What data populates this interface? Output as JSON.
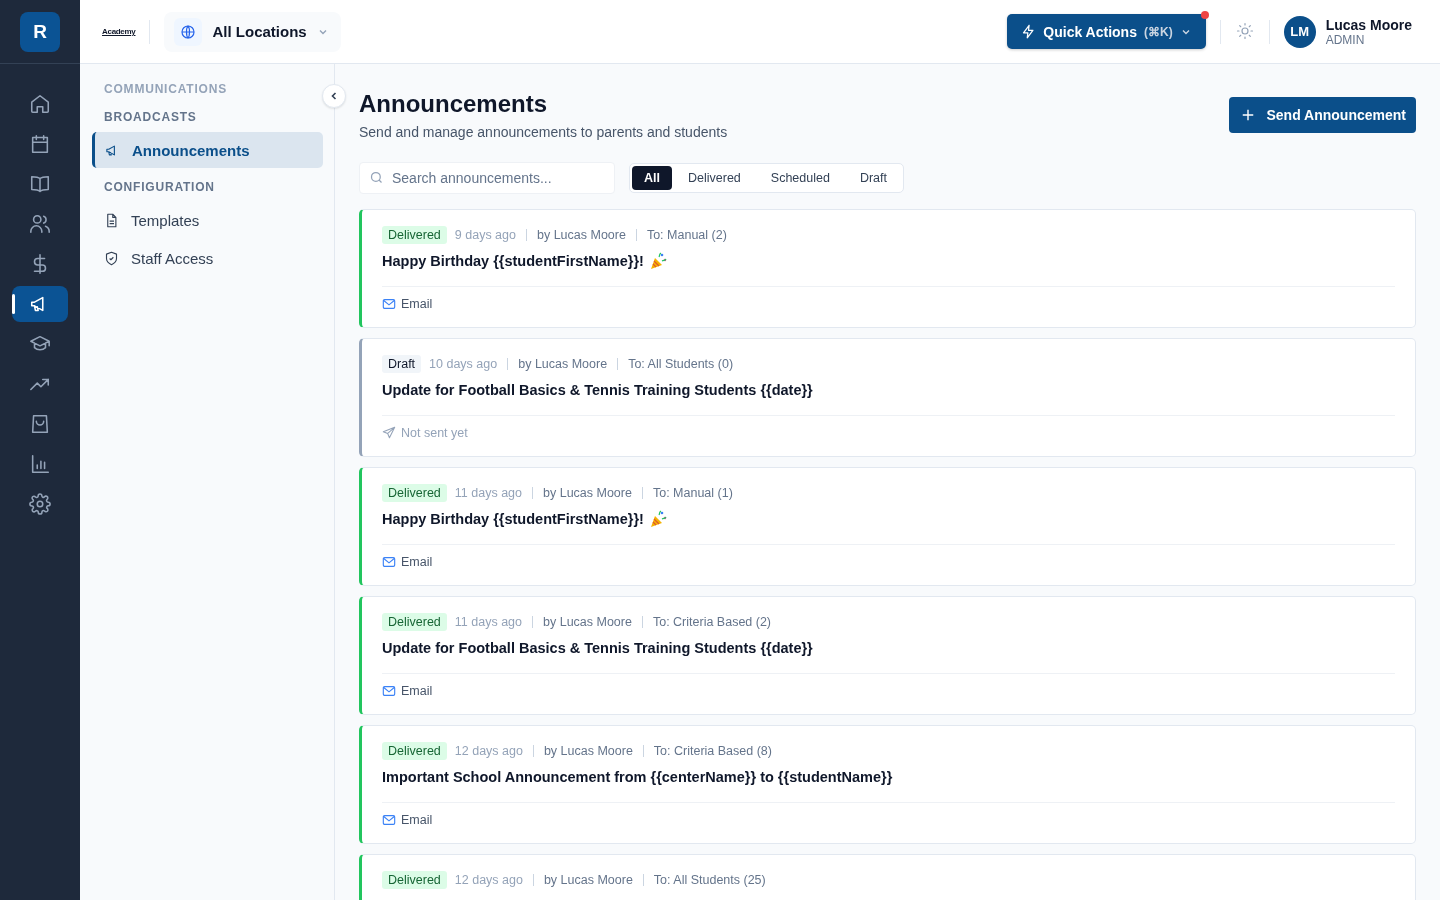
{
  "rail": {
    "logo": "R",
    "items": [
      {
        "selected": false
      },
      {
        "selected": false
      },
      {
        "selected": false
      },
      {
        "selected": false
      },
      {
        "selected": false
      },
      {
        "selected": true
      },
      {
        "selected": false
      },
      {
        "selected": false
      },
      {
        "selected": false
      },
      {
        "selected": false
      },
      {
        "selected": false
      }
    ]
  },
  "header": {
    "brand": "Academy",
    "location": "All Locations",
    "quick_actions": {
      "label": "Quick Actions",
      "shortcut": "(⌘K)",
      "notification": true
    },
    "user": {
      "initials": "LM",
      "name": "Lucas Moore",
      "role": "ADMIN"
    }
  },
  "sidebar": {
    "title": "COMMUNICATIONS",
    "sections": [
      {
        "heading": "BROADCASTS",
        "items": [
          {
            "label": "Announcements",
            "selected": true
          }
        ]
      },
      {
        "heading": "CONFIGURATION",
        "items": [
          {
            "label": "Templates",
            "selected": false
          },
          {
            "label": "Staff Access",
            "selected": false
          }
        ]
      }
    ]
  },
  "page": {
    "title": "Announcements",
    "subtitle": "Send and manage announcements to parents and students",
    "primary_button": "Send Announcement",
    "search": {
      "placeholder": "Search announcements..."
    },
    "filters": [
      {
        "label": "All",
        "selected": true
      },
      {
        "label": "Delivered",
        "selected": false
      },
      {
        "label": "Scheduled",
        "selected": false
      },
      {
        "label": "Draft",
        "selected": false
      }
    ]
  },
  "announcements": [
    {
      "status": "Delivered",
      "kind": "delivered",
      "time": "9 days ago",
      "author": "by Lucas Moore",
      "recipients": "To: Manual (2)",
      "title": "Happy Birthday {{studentFirstName}}!",
      "celebration": true,
      "channel": "Email"
    },
    {
      "status": "Draft",
      "kind": "draft",
      "time": "10 days ago",
      "author": "by Lucas Moore",
      "recipients": "To: All Students (0)",
      "title": "Update for Football Basics & Tennis Training Students {{date}}",
      "celebration": false,
      "channel": "Not sent yet"
    },
    {
      "status": "Delivered",
      "kind": "delivered",
      "time": "11 days ago",
      "author": "by Lucas Moore",
      "recipients": "To: Manual (1)",
      "title": "Happy Birthday {{studentFirstName}}!",
      "celebration": true,
      "channel": "Email"
    },
    {
      "status": "Delivered",
      "kind": "delivered",
      "time": "11 days ago",
      "author": "by Lucas Moore",
      "recipients": "To: Criteria Based (2)",
      "title": "Update for Football Basics & Tennis Training Students {{date}}",
      "celebration": false,
      "channel": "Email"
    },
    {
      "status": "Delivered",
      "kind": "delivered",
      "time": "12 days ago",
      "author": "by Lucas Moore",
      "recipients": "To: Criteria Based (8)",
      "title": "Important School Announcement from {{centerName}} to {{studentName}}",
      "celebration": false,
      "channel": "Email"
    },
    {
      "status": "Delivered",
      "kind": "delivered",
      "time": "12 days ago",
      "author": "by Lucas Moore",
      "recipients": "To: All Students (25)"
    }
  ]
}
